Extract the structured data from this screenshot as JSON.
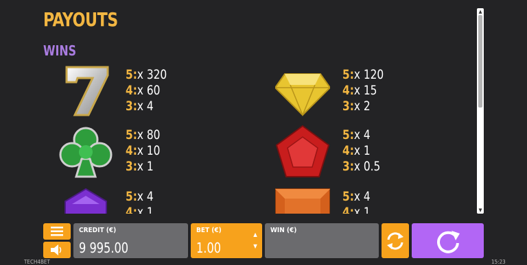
{
  "title": "PAYOUTS",
  "subtitle": "WINS",
  "symbols": [
    {
      "name": "seven",
      "pays": [
        {
          "count": "5:",
          "mult": "x 320"
        },
        {
          "count": "4:",
          "mult": "x 60"
        },
        {
          "count": "3:",
          "mult": "x 4"
        }
      ]
    },
    {
      "name": "yellow-diamond",
      "pays": [
        {
          "count": "5:",
          "mult": "x 120"
        },
        {
          "count": "4:",
          "mult": "x 15"
        },
        {
          "count": "3:",
          "mult": "x 2"
        }
      ]
    },
    {
      "name": "green-clover",
      "pays": [
        {
          "count": "5:",
          "mult": "x 80"
        },
        {
          "count": "4:",
          "mult": "x 10"
        },
        {
          "count": "3:",
          "mult": "x 1"
        }
      ]
    },
    {
      "name": "red-pentagon",
      "pays": [
        {
          "count": "5:",
          "mult": "x 4"
        },
        {
          "count": "4:",
          "mult": "x 1"
        },
        {
          "count": "3:",
          "mult": "x 0.5"
        }
      ]
    },
    {
      "name": "purple-gem",
      "pays": [
        {
          "count": "5:",
          "mult": "x 4"
        },
        {
          "count": "4:",
          "mult": "x 1"
        }
      ]
    },
    {
      "name": "orange-gem",
      "pays": [
        {
          "count": "5:",
          "mult": "x 4"
        },
        {
          "count": "4:",
          "mult": "x 1"
        }
      ]
    }
  ],
  "controls": {
    "credit_label": "CREDIT (€)",
    "credit_value": "9 995.00",
    "bet_label": "BET (€)",
    "bet_value": "1.00",
    "win_label": "WIN (€)",
    "win_value": ""
  },
  "footer": {
    "brand": "TECH4BET",
    "time": "15:23"
  },
  "colors": {
    "accent": "#f2b642",
    "subtitle": "#a97ce0",
    "orange": "#f7a21c",
    "spin": "#b266f5",
    "panel": "#6b6b6e"
  },
  "icons": [
    "menu-icon",
    "sound-icon",
    "autoplay-icon",
    "spin-icon"
  ]
}
